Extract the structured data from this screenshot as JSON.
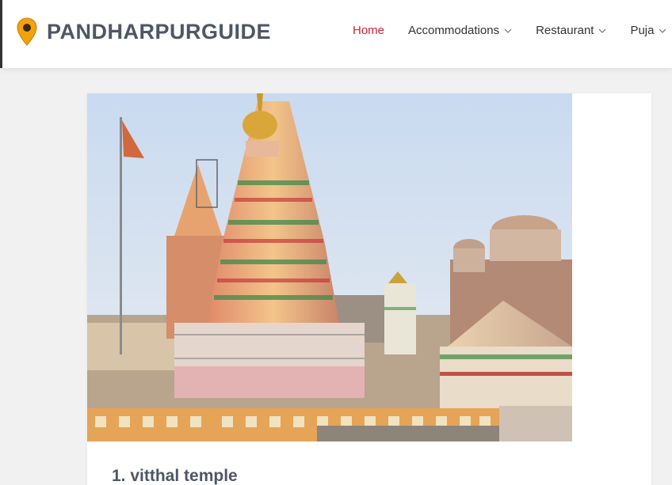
{
  "site": {
    "logo_text": "PANDHARPURGUIDE",
    "logo_icon": "map-pin-icon",
    "accent_color": "#d0243a"
  },
  "nav": {
    "items": [
      {
        "label": "Home",
        "active": true,
        "dropdown": false
      },
      {
        "label": "Accommodations",
        "active": false,
        "dropdown": true
      },
      {
        "label": "Restaurant",
        "active": false,
        "dropdown": true
      },
      {
        "label": "Puja",
        "active": false,
        "dropdown": true
      }
    ]
  },
  "main": {
    "card": {
      "image_alt": "",
      "title": "1. vitthal temple"
    }
  }
}
